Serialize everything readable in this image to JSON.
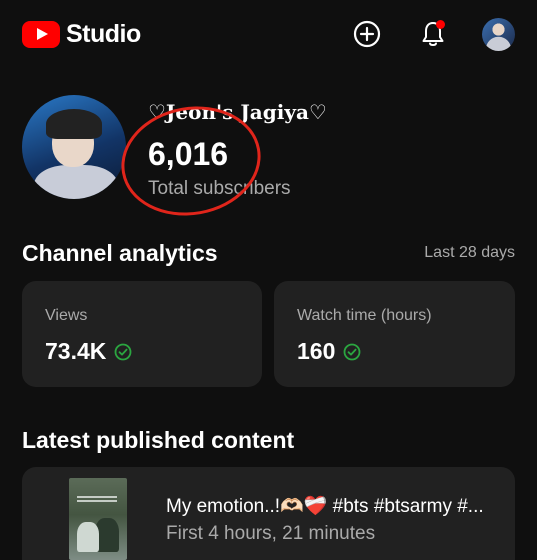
{
  "header": {
    "logo_text": "Studio",
    "create_icon": "add-circle-icon",
    "notifications_icon": "bell-icon",
    "has_notification_dot": true
  },
  "channel": {
    "name": "♡Jeon's Jagiya♡",
    "subscriber_count": "6,016",
    "subscriber_label": "Total subscribers"
  },
  "analytics": {
    "title": "Channel analytics",
    "period": "Last 28 days",
    "cards": [
      {
        "label": "Views",
        "value": "73.4K",
        "status_icon": "check-circle-icon"
      },
      {
        "label": "Watch time (hours)",
        "value": "160",
        "status_icon": "check-circle-icon"
      }
    ]
  },
  "latest": {
    "title": "Latest published content",
    "items": [
      {
        "title": "My emotion..!🫶🏻❤️‍🩹 #bts #btsarmy #...",
        "meta": "First 4 hours, 21 minutes"
      }
    ]
  },
  "colors": {
    "background": "#0f0f0f",
    "card": "#212121",
    "brand_red": "#ff0000",
    "success_green": "#2ba640",
    "annotation_red": "#e0251b",
    "secondary_text": "#aaaaaa"
  }
}
